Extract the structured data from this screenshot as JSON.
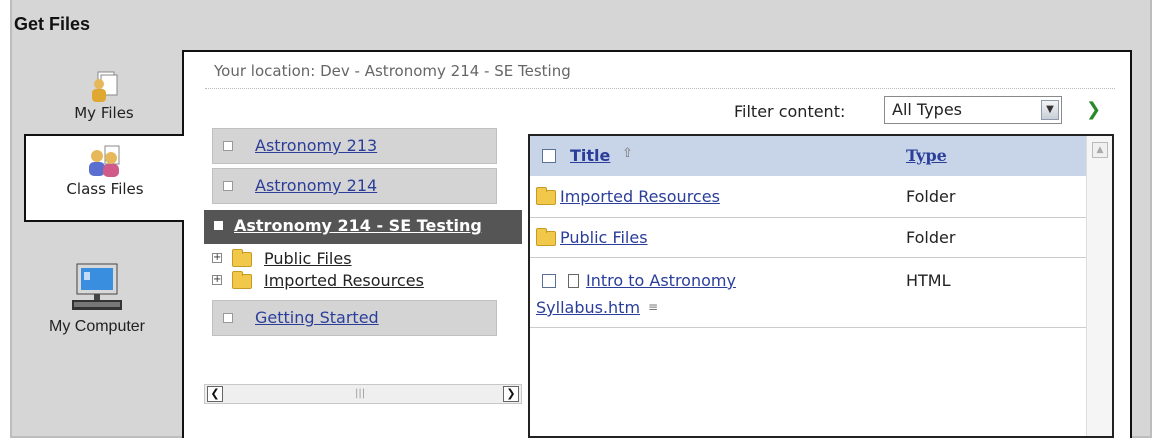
{
  "dialog": {
    "title": "Get Files"
  },
  "tabs": [
    {
      "label": "My Files",
      "icon": "my-files-icon"
    },
    {
      "label": "Class Files",
      "icon": "class-files-icon"
    },
    {
      "label": "My Computer",
      "icon": "computer-icon"
    }
  ],
  "location": {
    "text": "Your location: Dev - Astronomy 214 - SE Testing"
  },
  "filter": {
    "label": "Filter content:",
    "value": "All Types",
    "go_icon": "go-arrow-icon"
  },
  "tree": {
    "items": [
      {
        "label": "Astronomy 213"
      },
      {
        "label": "Astronomy 214"
      }
    ],
    "selected": "Astronomy 214 - SE Testing",
    "children": [
      {
        "label": "Public Files"
      },
      {
        "label": "Imported Resources"
      }
    ],
    "after": [
      {
        "label": "Getting Started"
      }
    ]
  },
  "files": {
    "columns": {
      "title": "Title",
      "type": "Type"
    },
    "rows": [
      {
        "title": "Imported Resources",
        "type": "Folder",
        "kind": "folder"
      },
      {
        "title": "Public Files",
        "type": "Folder",
        "kind": "folder"
      },
      {
        "title_line1": "Intro to Astronomy",
        "title_line2": "Syllabus.htm",
        "type": "HTML",
        "kind": "file"
      }
    ]
  },
  "colors": {
    "header_bg": "#c8d4e8",
    "selected_bg": "#555555",
    "link": "#2a3e9a"
  }
}
